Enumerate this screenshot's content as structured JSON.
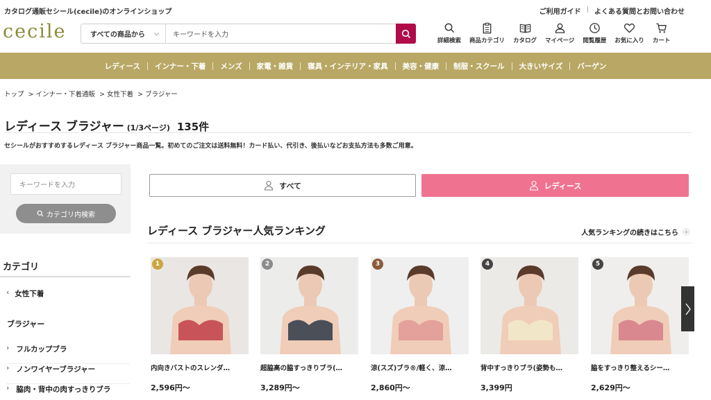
{
  "header": {
    "tagline": "カタログ通販セシール(cecile)のオンラインショップ",
    "links": [
      "ご利用ガイド",
      "よくある質問とお問い合わせ"
    ],
    "logo": "cecile",
    "search": {
      "category": "すべての商品から",
      "placeholder": "キーワードを入力"
    },
    "icons": [
      {
        "label": "詳細検索",
        "icon": "search-icon"
      },
      {
        "label": "商品カテゴリ",
        "icon": "clipboard-icon"
      },
      {
        "label": "カタログ",
        "icon": "book-icon"
      },
      {
        "label": "マイページ",
        "icon": "user-icon"
      },
      {
        "label": "閲覧履歴",
        "icon": "clock-icon"
      },
      {
        "label": "お気に入り",
        "icon": "heart-icon"
      },
      {
        "label": "カート",
        "icon": "cart-icon"
      }
    ]
  },
  "nav": [
    "レディース",
    "インナー・下着",
    "メンズ",
    "家電・雑貨",
    "寝具・インテリア・家具",
    "美容・健康",
    "制服・スクール",
    "大きいサイズ",
    "バーゲン"
  ],
  "breadcrumb": [
    "トップ",
    "> インナー・下着通販",
    "> 女性下着",
    "> ブラジャー"
  ],
  "page": {
    "title": "レディース ブラジャー",
    "page_info": "(1/3ページ)",
    "count": "135件",
    "description": "セシールがおすすめするレディース ブラジャー商品一覧。初めてのご注文は送料無料！カード払い、代引き、後払いなどお支払方法も多数ご用意。"
  },
  "sidebar": {
    "search_placeholder": "キーワードを入力",
    "search_button": "カテゴリ内検索",
    "category_heading": "カテゴリ",
    "parent": "女性下着",
    "current": "ブラジャー",
    "items": [
      "フルカップブラ",
      "ノンワイヤーブラジャー",
      "脇肉・背中の肉すっきりブラ"
    ]
  },
  "tabs": {
    "all": "すべて",
    "ladies": "レディース"
  },
  "ranking": {
    "heading": "レディース ブラジャー人気ランキング",
    "more": "人気ランキングの続きはこちら",
    "items": [
      {
        "rank": "1",
        "name": "内向きバストのスレンダ…",
        "price": "2,596円～",
        "badge_color": "#c9a640",
        "bra_color": "#c8545a"
      },
      {
        "rank": "2",
        "name": "超脇高の脇すっきりブラ(…",
        "price": "3,289円～",
        "badge_color": "#8c8c8c",
        "bra_color": "#4a4f58"
      },
      {
        "rank": "3",
        "name": "涼(スズ)ブラ®/軽く、涼…",
        "price": "2,860円～",
        "badge_color": "#8a5a3a",
        "bra_color": "#e4a09a"
      },
      {
        "rank": "4",
        "name": "背中すっきりブラ(姿勢も…",
        "price": "3,399円",
        "badge_color": "#444444",
        "bra_color": "#f2e6c8"
      },
      {
        "rank": "5",
        "name": "脇をすっきり整えるシー…",
        "price": "2,629円～",
        "badge_color": "#444444",
        "bra_color": "#d98890"
      }
    ]
  },
  "colors": {
    "nav_bg": "#b9a865",
    "search_btn": "#b00c4a",
    "ladies_tab": "#ef7390"
  }
}
